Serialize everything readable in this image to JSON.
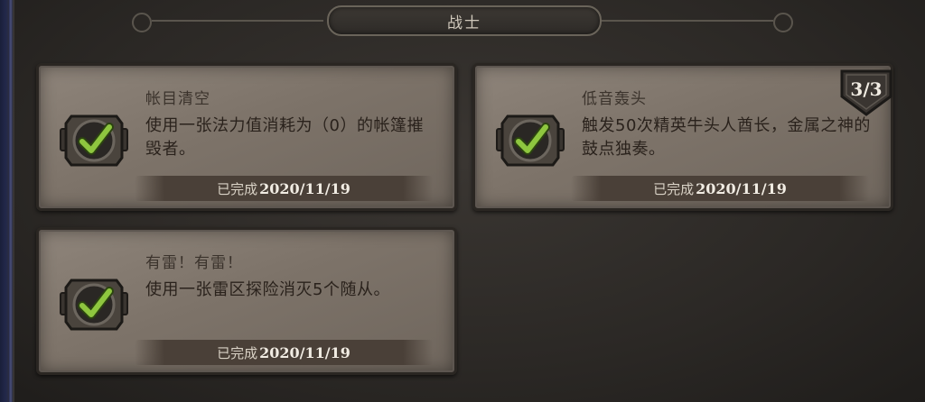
{
  "header": {
    "title": "战士"
  },
  "achievements": [
    {
      "title": "帐目清空",
      "description": "使用一张法力值消耗为（0）的帐篷摧毁者。",
      "completed_label": "已完成",
      "completed_date": "2020/11/19"
    },
    {
      "title": "低音轰头",
      "description": "触发50次精英牛头人酋长，金属之神的鼓点独奏。",
      "completed_label": "已完成",
      "completed_date": "2020/11/19",
      "progress": "3/3"
    },
    {
      "title": "有雷！有雷！",
      "description": "使用一张雷区探险消灭5个随从。",
      "completed_label": "已完成",
      "completed_date": "2020/11/19"
    }
  ],
  "icons": {
    "complete": "checkmark-icon",
    "progress": "progress-banner-icon"
  },
  "colors": {
    "check_green": "#8ec63f",
    "card_bg": "#847a70",
    "page_bg": "#2e2b28"
  }
}
